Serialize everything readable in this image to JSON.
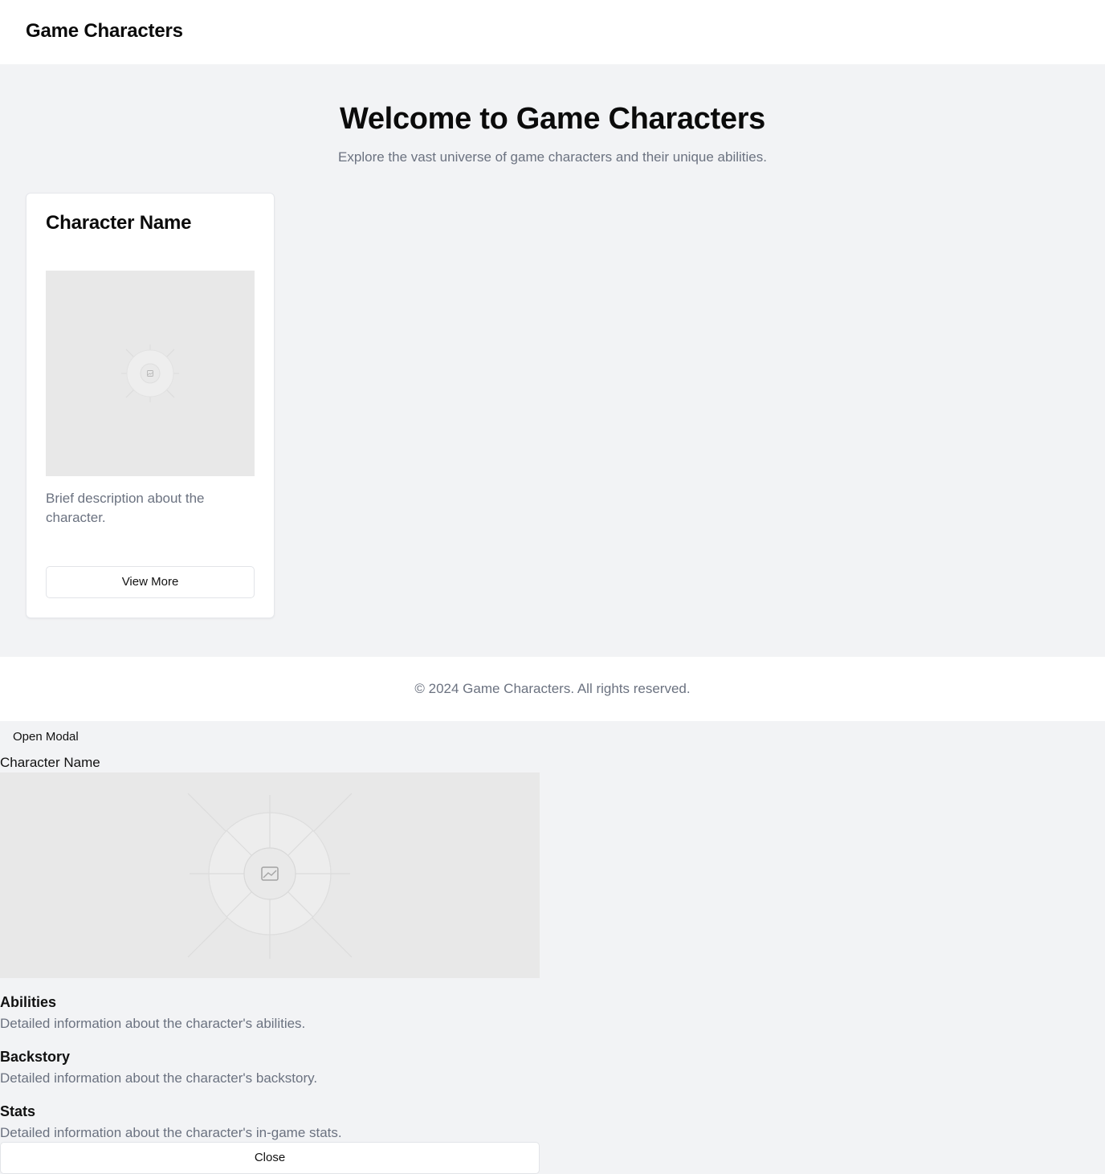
{
  "header": {
    "brand": "Game Characters"
  },
  "hero": {
    "title": "Welcome to Game Characters",
    "subtitle": "Explore the vast universe of game characters and their unique abilities."
  },
  "card": {
    "title": "Character Name",
    "image_icon": "image-placeholder-icon",
    "description": "Brief description about the character.",
    "button_label": "View More"
  },
  "footer": {
    "text": "© 2024 Game Characters. All rights reserved."
  },
  "modal": {
    "open_label": "Open Modal",
    "title": "Character Name",
    "image_icon": "image-placeholder-icon",
    "sections": [
      {
        "heading": "Abilities",
        "body": "Detailed information about the character's abilities."
      },
      {
        "heading": "Backstory",
        "body": "Detailed information about the character's backstory."
      },
      {
        "heading": "Stats",
        "body": "Detailed information about the character's in-game stats."
      }
    ],
    "close_label": "Close"
  },
  "colors": {
    "page_bg": "#f2f3f5",
    "surface": "#ffffff",
    "placeholder_bg": "#e8e8e8",
    "muted_text": "#6b7280",
    "heading_text": "#0b0b0b"
  }
}
